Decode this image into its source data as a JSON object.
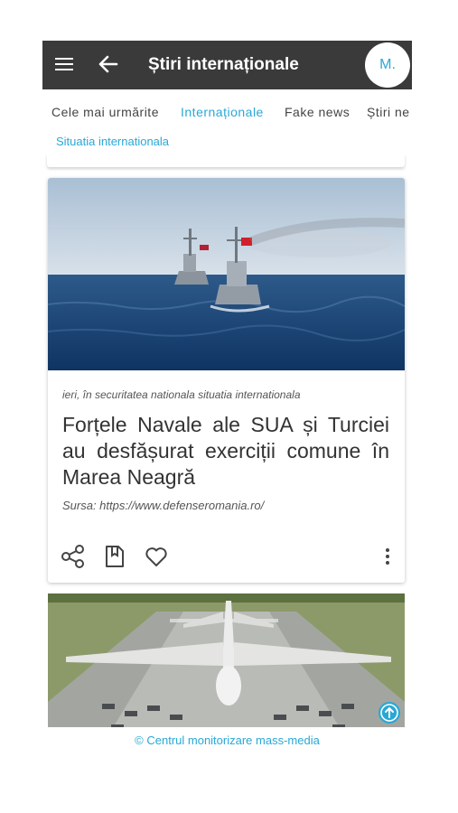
{
  "appbar": {
    "title": "Știri internaționale",
    "avatar_text": "M."
  },
  "tabs": [
    {
      "label": "Cele mai urmărite"
    },
    {
      "label": "Internaționale"
    },
    {
      "label": "Fake news"
    },
    {
      "label": "Știri ne"
    }
  ],
  "active_tab": "Internaționale",
  "subtab": {
    "label": "Situatia internationala"
  },
  "article": {
    "meta": "ieri, în securitatea nationala situatia internationala",
    "headline": "Forțele Navale ale SUA și Turciei au desfășurat exerciții comune în Marea Neagră",
    "source": "Sursa: https://www.defenseromania.ro/",
    "image_icon": "warships-photo"
  },
  "article2": {
    "image_icon": "bomber-aircraft-photo"
  },
  "footer": {
    "text": "© Centrul monitorizare mass-media"
  },
  "colors": {
    "appbar": "#3a3a3a",
    "accent": "#29a8d6",
    "text": "#333333"
  }
}
